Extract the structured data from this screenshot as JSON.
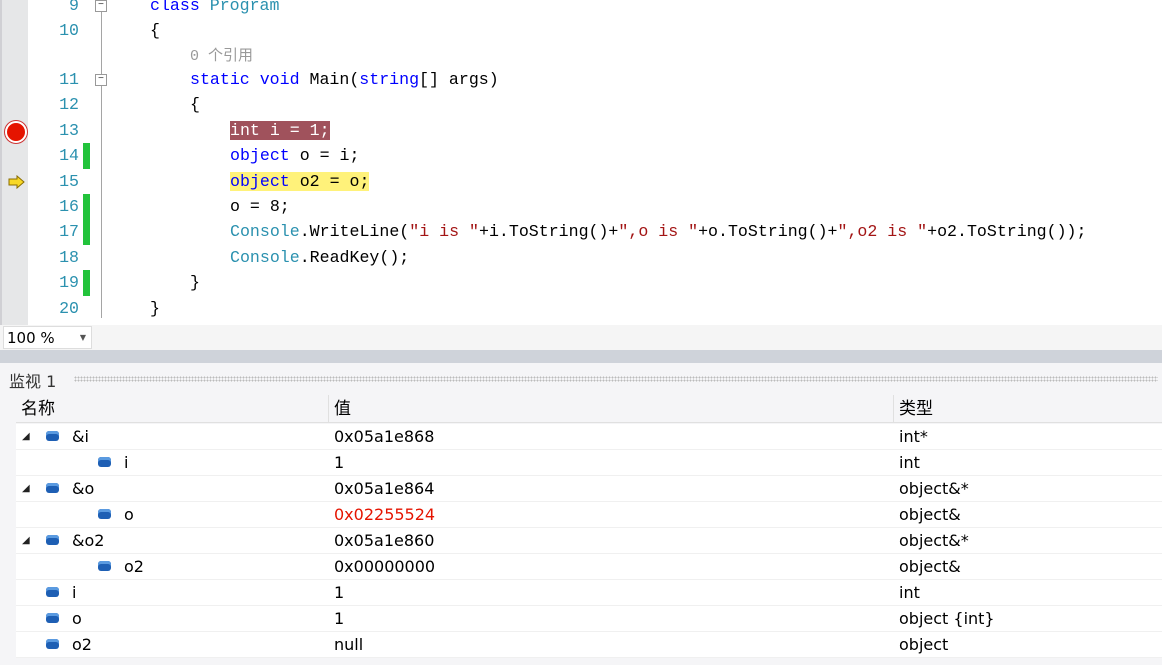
{
  "editor": {
    "lines": [
      {
        "num": "9",
        "tokens": [
          {
            "t": "class ",
            "c": "kw"
          },
          {
            "t": "Program",
            "c": "ty"
          }
        ],
        "fold": true
      },
      {
        "num": "10",
        "tokens": [
          {
            "t": "{",
            "c": "pl"
          }
        ]
      },
      {
        "num": "",
        "lens": "0 个引用",
        "indent": 4
      },
      {
        "num": "11",
        "indent": 4,
        "fold": true,
        "tokens": [
          {
            "t": "static void ",
            "c": "kw"
          },
          {
            "t": "Main(",
            "c": "pl"
          },
          {
            "t": "string",
            "c": "kw"
          },
          {
            "t": "[] args)",
            "c": "pl"
          }
        ]
      },
      {
        "num": "12",
        "indent": 4,
        "tokens": [
          {
            "t": "{",
            "c": "pl"
          }
        ]
      },
      {
        "num": "13",
        "indent": 8,
        "hl": "bp",
        "tokens": [
          {
            "t": "int i = 1;",
            "c": ""
          }
        ]
      },
      {
        "num": "14",
        "indent": 8,
        "changed": true,
        "tokens": [
          {
            "t": "object",
            "c": "kw"
          },
          {
            "t": " o = i;",
            "c": "pl"
          }
        ]
      },
      {
        "num": "15",
        "indent": 8,
        "hl": "cur",
        "tokens": [
          {
            "t": "object",
            "c": "kw"
          },
          {
            "t": " o2 = o;",
            "c": "pl"
          }
        ]
      },
      {
        "num": "16",
        "indent": 8,
        "changed": true,
        "tokens": [
          {
            "t": "o = 8;",
            "c": "pl"
          }
        ]
      },
      {
        "num": "17",
        "indent": 8,
        "changed": true,
        "tokens": [
          {
            "t": "Console",
            "c": "ty"
          },
          {
            "t": ".WriteLine(",
            "c": "pl"
          },
          {
            "t": "\"i is \"",
            "c": "st"
          },
          {
            "t": "+i.ToString()+",
            "c": "pl"
          },
          {
            "t": "\",o is \"",
            "c": "st"
          },
          {
            "t": "+o.ToString()+",
            "c": "pl"
          },
          {
            "t": "\",o2 is \"",
            "c": "st"
          },
          {
            "t": "+o2.ToString());",
            "c": "pl"
          }
        ]
      },
      {
        "num": "18",
        "indent": 8,
        "tokens": [
          {
            "t": "Console",
            "c": "ty"
          },
          {
            "t": ".ReadKey();",
            "c": "pl"
          }
        ]
      },
      {
        "num": "19",
        "indent": 4,
        "changed": true,
        "tokens": [
          {
            "t": "}",
            "c": "pl"
          }
        ]
      },
      {
        "num": "20",
        "tokens": [
          {
            "t": "}",
            "c": "pl"
          }
        ]
      }
    ]
  },
  "zoom": {
    "value": "100 %"
  },
  "watch": {
    "title": "监视 1",
    "columns": {
      "name": "名称",
      "value": "值",
      "type": "类型"
    },
    "rows": [
      {
        "name": "&i",
        "value": "0x05a1e868",
        "type": "int*",
        "level": 0,
        "expanded": true
      },
      {
        "name": "i",
        "value": "1",
        "type": "int",
        "level": 1
      },
      {
        "name": "&o",
        "value": "0x05a1e864",
        "type": "object&*",
        "level": 0,
        "expanded": true
      },
      {
        "name": "o",
        "value": "0x02255524",
        "type": "object&",
        "level": 1,
        "changed": true
      },
      {
        "name": "&o2",
        "value": "0x05a1e860",
        "type": "object&*",
        "level": 0,
        "expanded": true
      },
      {
        "name": "o2",
        "value": "0x00000000",
        "type": "object&",
        "level": 1
      },
      {
        "name": "i",
        "value": "1",
        "type": "int",
        "level": 0
      },
      {
        "name": "o",
        "value": "1",
        "type": "object {int}",
        "level": 0
      },
      {
        "name": "o2",
        "value": "null",
        "type": "object",
        "level": 0
      }
    ]
  }
}
